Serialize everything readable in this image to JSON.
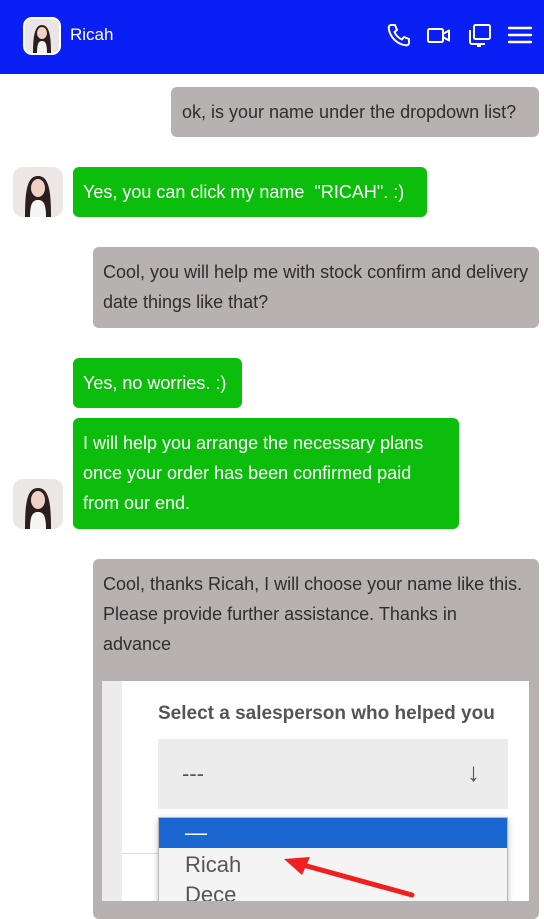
{
  "header": {
    "contact_name": "Ricah",
    "icons": [
      "phone-icon",
      "video-icon",
      "copy-icon",
      "menu-icon"
    ]
  },
  "messages": [
    {
      "side": "out",
      "text": "ok, is your name under the dropdown list?"
    },
    {
      "side": "in",
      "text": "Yes, you can click my name  \"RICAH\". :)"
    },
    {
      "side": "out",
      "text": "Cool, you will help me with stock confirm and delivery date things like that?"
    },
    {
      "side": "in",
      "text": "Yes, no worries. :)"
    },
    {
      "side": "in",
      "text": "I will help you arrange the necessary plans once your order has been confirmed paid from our end."
    },
    {
      "side": "out",
      "text": "Cool, thanks Ricah, I will choose your name like this. Please provide further assistance. Thanks in advance"
    }
  ],
  "attachment": {
    "title": "Select a salesperson who helped you",
    "select_value": "---",
    "options": [
      "—",
      "Ricah",
      "Dece"
    ],
    "selected_option": "—"
  },
  "colors": {
    "header": "#0a1ff5",
    "incoming": "#0cbd0c",
    "outgoing": "#b8b1b1",
    "highlight": "#1a67d2",
    "arrow": "#f02020"
  }
}
